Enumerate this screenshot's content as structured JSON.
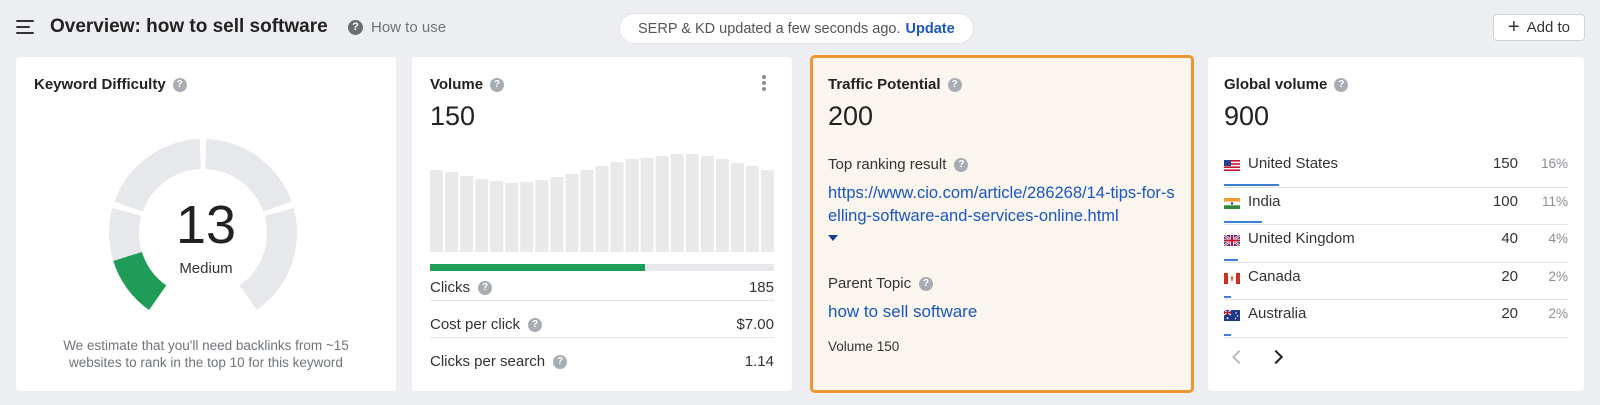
{
  "header": {
    "title": "Overview: how to sell software",
    "how_to_use": "How to use",
    "serp_status": "SERP & KD updated a few seconds ago.",
    "update_label": "Update",
    "add_to_label": "Add to"
  },
  "kd_card": {
    "title": "Keyword Difficulty",
    "value": "13",
    "value_fraction": 0.13,
    "label": "Medium",
    "note": "We estimate that you'll need backlinks from ~15 websites to rank in the top 10 for this keyword",
    "color_filled": "#1f9d58",
    "color_track": "#e6e8eb"
  },
  "volume_card": {
    "title": "Volume",
    "value": "150",
    "history_bars_relative": [
      0.82,
      0.8,
      0.76,
      0.73,
      0.71,
      0.69,
      0.7,
      0.72,
      0.75,
      0.78,
      0.82,
      0.86,
      0.9,
      0.93,
      0.94,
      0.96,
      0.98,
      0.98,
      0.96,
      0.93,
      0.89,
      0.86,
      0.82
    ],
    "clicks_fraction": 0.625,
    "stats": [
      {
        "label": "Clicks",
        "value": "185"
      },
      {
        "label": "Cost per click",
        "value": "$7.00"
      },
      {
        "label": "Clicks per search",
        "value": "1.14"
      }
    ],
    "bar_color": "#e8e9eb",
    "clicks_color": "#1f9d58"
  },
  "tp_card": {
    "title": "Traffic Potential",
    "value": "200",
    "top_result_label": "Top ranking result",
    "top_result_url": "https://www.cio.com/article/286268/14-tips-for-selling-software-and-services-online.html",
    "parent_topic_label": "Parent Topic",
    "parent_topic": "how to sell software",
    "parent_volume": "Volume 150",
    "highlight_color": "#f0962e"
  },
  "gv_card": {
    "title": "Global volume",
    "value": "900",
    "countries": [
      {
        "name": "United States",
        "volume": "150",
        "pct": "16%",
        "share": 0.16,
        "flag": "us-flag-icon"
      },
      {
        "name": "India",
        "volume": "100",
        "pct": "11%",
        "share": 0.11,
        "flag": "india-flag-icon"
      },
      {
        "name": "United Kingdom",
        "volume": "40",
        "pct": "4%",
        "share": 0.04,
        "flag": "uk-flag-icon"
      },
      {
        "name": "Canada",
        "volume": "20",
        "pct": "2%",
        "share": 0.02,
        "flag": "canada-flag-icon"
      },
      {
        "name": "Australia",
        "volume": "20",
        "pct": "2%",
        "share": 0.02,
        "flag": "australia-flag-icon"
      }
    ]
  }
}
